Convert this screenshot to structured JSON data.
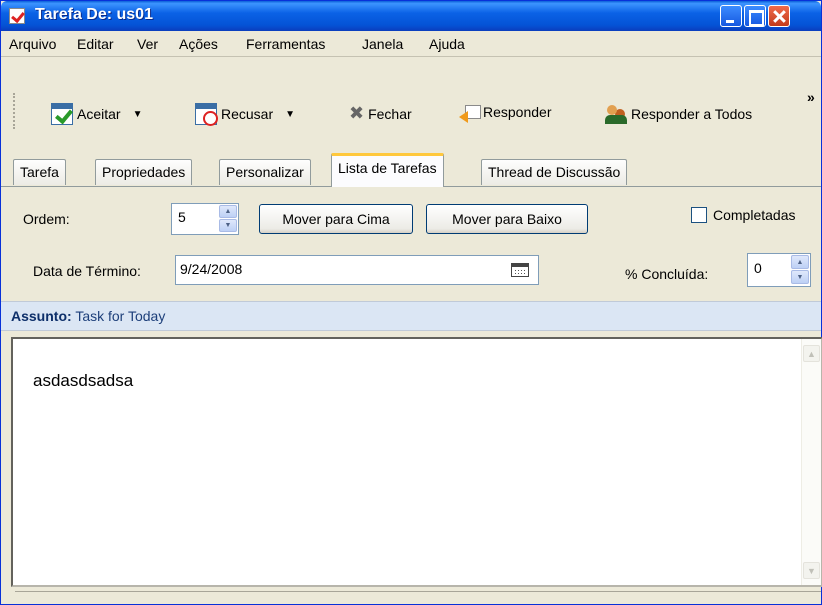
{
  "window": {
    "title": "Tarefa De: us01"
  },
  "menu": [
    "Arquivo",
    "Editar",
    "Ver",
    "Ações",
    "Ferramentas",
    "Janela",
    "Ajuda"
  ],
  "toolbar": {
    "accept_label": "Aceitar",
    "decline_label": "Recusar",
    "close_label": "Fechar",
    "reply_label": "Responder",
    "reply_all_label": "Responder a Todos",
    "more_label": "»"
  },
  "tabs": [
    {
      "label": "Tarefa"
    },
    {
      "label": "Propriedades"
    },
    {
      "label": "Personalizar"
    },
    {
      "label": "Lista de Tarefas",
      "active": true
    },
    {
      "label": "Thread de Discussão"
    }
  ],
  "form": {
    "order_label": "Ordem:",
    "order_value": "5",
    "move_up_label": "Mover para Cima",
    "move_down_label": "Mover para Baixo",
    "completed_label": "Completadas",
    "due_date_label": "Data de Término:",
    "due_date_value": "9/24/2008",
    "percent_label": "% Concluída:",
    "percent_value": "0"
  },
  "subject": {
    "label": "Assunto:",
    "value": "Task for Today"
  },
  "body": {
    "text": "asdasdsadsa"
  },
  "colors": {
    "titlebar": "#0453d6",
    "window_bg": "#ece9d8",
    "subject_bg": "#dbe6f4",
    "active_tab_accent": "#ffc83c"
  }
}
